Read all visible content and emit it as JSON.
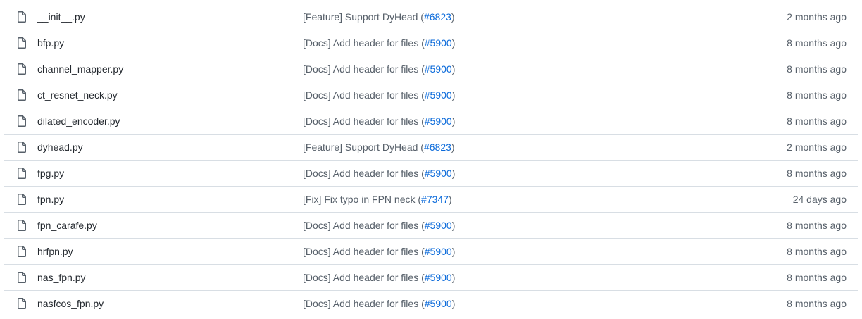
{
  "files": [
    {
      "name": "__init__.py",
      "commit_prefix": "[Feature] Support DyHead (",
      "commit_pr": "#6823",
      "commit_suffix": ")",
      "age": "2 months ago"
    },
    {
      "name": "bfp.py",
      "commit_prefix": "[Docs] Add header for files (",
      "commit_pr": "#5900",
      "commit_suffix": ")",
      "age": "8 months ago"
    },
    {
      "name": "channel_mapper.py",
      "commit_prefix": "[Docs] Add header for files (",
      "commit_pr": "#5900",
      "commit_suffix": ")",
      "age": "8 months ago"
    },
    {
      "name": "ct_resnet_neck.py",
      "commit_prefix": "[Docs] Add header for files (",
      "commit_pr": "#5900",
      "commit_suffix": ")",
      "age": "8 months ago"
    },
    {
      "name": "dilated_encoder.py",
      "commit_prefix": "[Docs] Add header for files (",
      "commit_pr": "#5900",
      "commit_suffix": ")",
      "age": "8 months ago"
    },
    {
      "name": "dyhead.py",
      "commit_prefix": "[Feature] Support DyHead (",
      "commit_pr": "#6823",
      "commit_suffix": ")",
      "age": "2 months ago"
    },
    {
      "name": "fpg.py",
      "commit_prefix": "[Docs] Add header for files (",
      "commit_pr": "#5900",
      "commit_suffix": ")",
      "age": "8 months ago"
    },
    {
      "name": "fpn.py",
      "commit_prefix": "[Fix] Fix typo in FPN neck (",
      "commit_pr": "#7347",
      "commit_suffix": ")",
      "age": "24 days ago"
    },
    {
      "name": "fpn_carafe.py",
      "commit_prefix": "[Docs] Add header for files (",
      "commit_pr": "#5900",
      "commit_suffix": ")",
      "age": "8 months ago"
    },
    {
      "name": "hrfpn.py",
      "commit_prefix": "[Docs] Add header for files (",
      "commit_pr": "#5900",
      "commit_suffix": ")",
      "age": "8 months ago"
    },
    {
      "name": "nas_fpn.py",
      "commit_prefix": "[Docs] Add header for files (",
      "commit_pr": "#5900",
      "commit_suffix": ")",
      "age": "8 months ago"
    },
    {
      "name": "nasfcos_fpn.py",
      "commit_prefix": "[Docs] Add header for files (",
      "commit_pr": "#5900",
      "commit_suffix": ")",
      "age": "8 months ago"
    }
  ],
  "icon": "file-icon",
  "colors": {
    "link": "#0969da",
    "muted": "#57606a",
    "border": "#d8dee4"
  }
}
